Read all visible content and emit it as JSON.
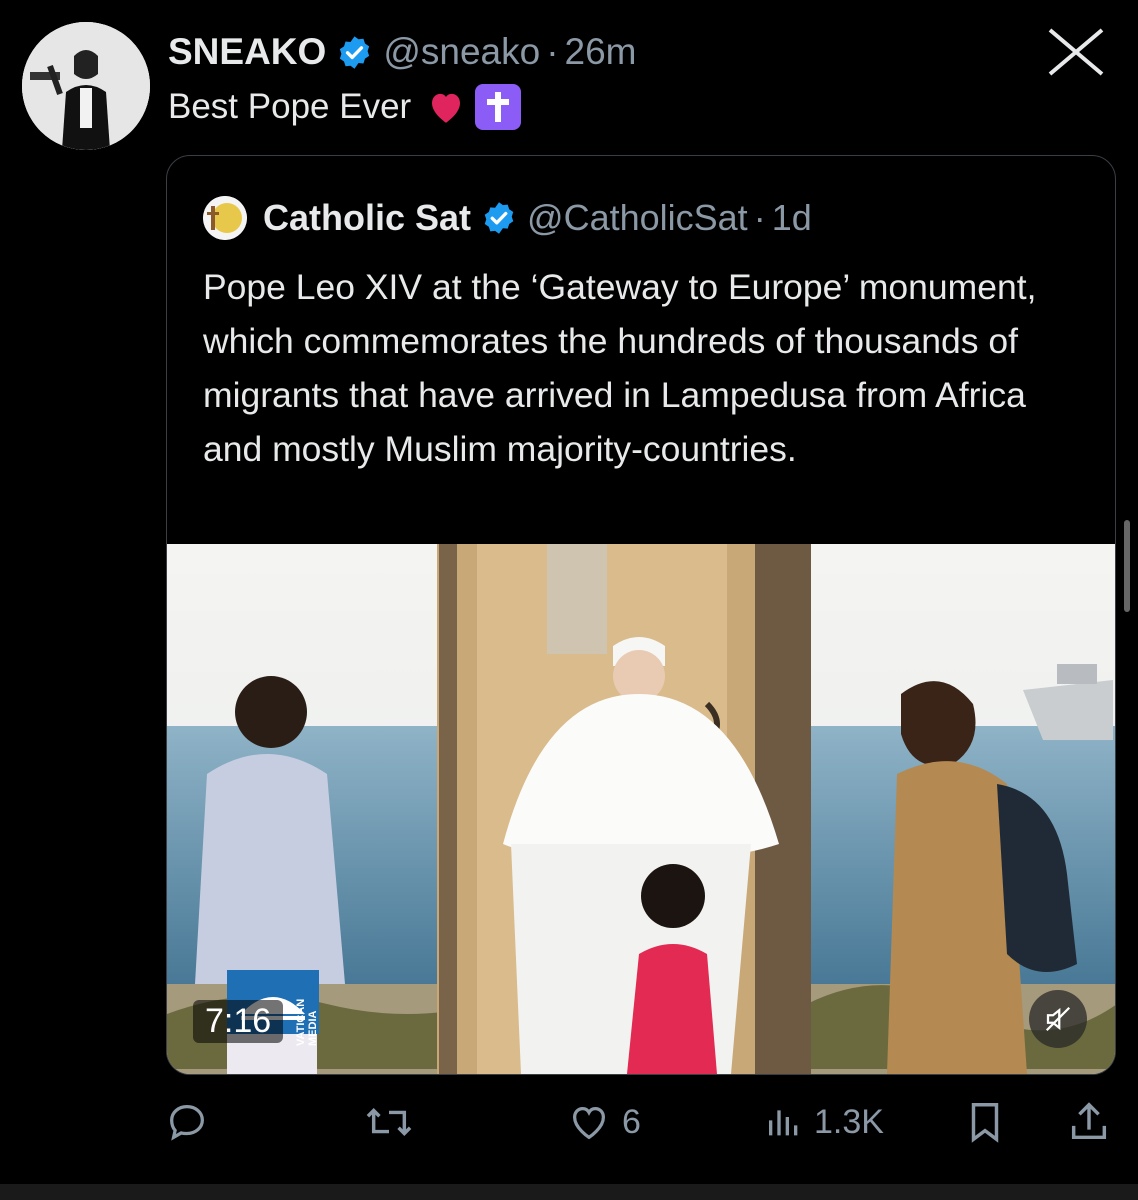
{
  "tweet": {
    "author_name": "SNEAKO",
    "author_handle": "@sneako",
    "separator": "·",
    "time": "26m",
    "text": "Best Pope Ever",
    "emojis": [
      "red-heart",
      "latin-cross"
    ]
  },
  "quoted": {
    "author_name": "Catholic Sat",
    "author_handle": "@CatholicSat",
    "separator": "·",
    "time": "1d",
    "avatar_text": "Catholic Sat",
    "text": "Pope Leo XIV at the ‘Gateway to Europe’ monument, which commemorates the hundreds of thousands of migrants that have arrived in Lampedusa from Africa and mostly Muslim majority-countries.",
    "video": {
      "duration": "7:16",
      "watermark_line1": "VATICAN",
      "watermark_line2": "MEDIA",
      "muted": true
    }
  },
  "actions": {
    "reply_count": "",
    "retweet_count": "",
    "like_count": "6",
    "views": "1.3K"
  },
  "colors": {
    "background": "#000000",
    "text": "#e7e9ea",
    "muted": "#8b98a5",
    "verified": "#1d9bf0",
    "border": "#3a3f45"
  },
  "icons": [
    "close-x-icon",
    "verified-badge-icon",
    "reply-icon",
    "retweet-icon",
    "like-icon",
    "views-icon",
    "bookmark-icon",
    "share-icon",
    "mute-icon"
  ]
}
